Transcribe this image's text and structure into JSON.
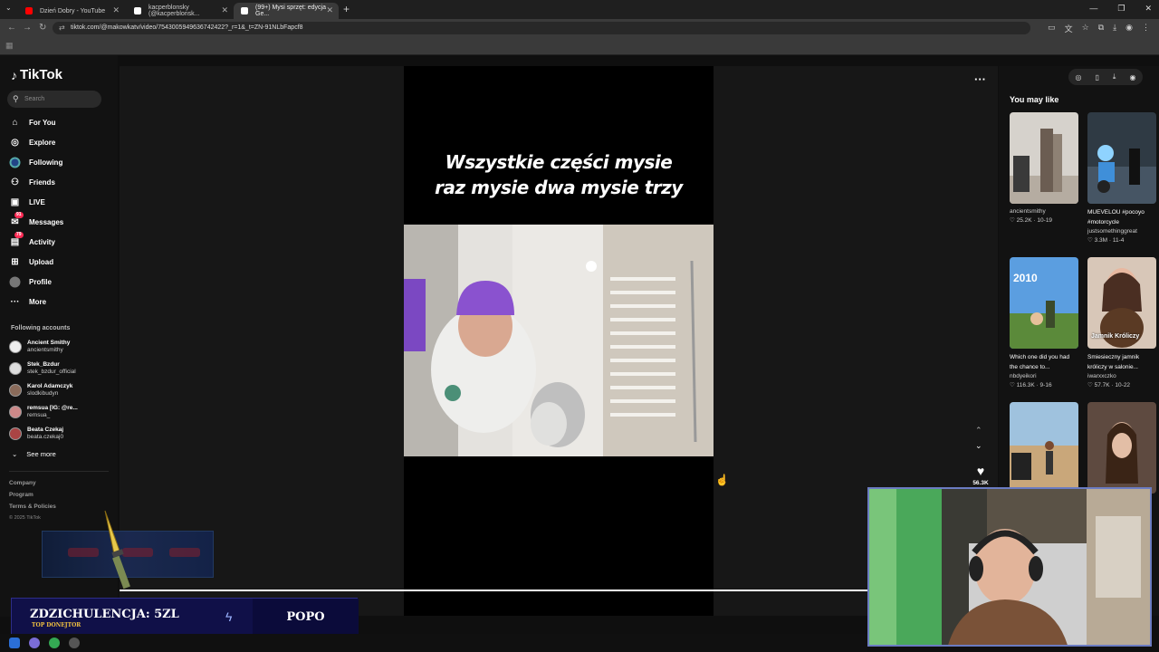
{
  "browser": {
    "tabs": [
      {
        "title": "Dzień Dobry - YouTube",
        "favicon_color": "#ff0000"
      },
      {
        "title": "kacperblonsky (@kacperblonsk...",
        "favicon_color": "#ffffff"
      },
      {
        "title": "(99+) Mysi sprzęt: edycja Ge...",
        "favicon_color": "#ffffff"
      }
    ],
    "url": "tiktok.com/@makowkatv/video/7543005949636742422?_r=1&_t=ZN-91NLbFapcf8"
  },
  "tiktok": {
    "logo": "TikTok",
    "search_placeholder": "Search",
    "nav": [
      {
        "label": "For You",
        "icon": "home-icon"
      },
      {
        "label": "Explore",
        "icon": "compass-icon"
      },
      {
        "label": "Following",
        "icon": "following-icon"
      },
      {
        "label": "Friends",
        "icon": "friends-icon"
      },
      {
        "label": "LIVE",
        "icon": "live-icon"
      },
      {
        "label": "Messages",
        "icon": "message-icon",
        "badge": "91"
      },
      {
        "label": "Activity",
        "icon": "inbox-icon",
        "badge": "79"
      },
      {
        "label": "Upload",
        "icon": "upload-icon"
      },
      {
        "label": "Profile",
        "icon": "profile-icon"
      },
      {
        "label": "More",
        "icon": "more-icon"
      }
    ],
    "following_header": "Following accounts",
    "following_accounts": [
      {
        "name": "Ancient Smithy",
        "handle": "ancientsmithy"
      },
      {
        "name": "Stek_Bzdur",
        "handle": "stek_bzdur_official"
      },
      {
        "name": "Karol Adamczyk",
        "handle": "slodkibudyn"
      },
      {
        "name": "remsua [IG: @re...",
        "handle": "remsua_"
      },
      {
        "name": "Beata Czekaj",
        "handle": "beata.czekaj0"
      }
    ],
    "see_more": "See more",
    "footer": [
      "Company",
      "Program",
      "Terms & Policies"
    ],
    "copyright": "© 2025 TikTok"
  },
  "video": {
    "caption_line1": "Wszystkie części mysie",
    "caption_line2": "raz mysie dwa mysie trzy",
    "likes": "56.3K"
  },
  "rail": {
    "header": "You may like",
    "cards": [
      {
        "title": "",
        "author": "ancientsmithy",
        "likes": "25.2K",
        "date": "10-19",
        "thumb_color": "#d6d2cc"
      },
      {
        "title": "MUEVELOU #pocoyo #motorcycle",
        "author": "justsomethinggreat",
        "likes": "3.3M",
        "date": "11-4",
        "thumb_color": "#2f3a44"
      },
      {
        "title": "Which one did you had the chance to...",
        "author": "nbdyeikori",
        "likes": "116.3K",
        "date": "9-16",
        "thumb_color": "#4c86c9",
        "overlay_text": "2010"
      },
      {
        "title": "Smiesieczny jamnik króliczy w salonie...",
        "author": "iwarxxczko",
        "likes": "57.7K",
        "date": "10-22",
        "thumb_color": "#c49a80",
        "overlay_text": "Jamnik Króliczy"
      },
      {
        "title": "",
        "author": "",
        "likes": "",
        "date": "",
        "thumb_color": "#c9a77a"
      },
      {
        "title": "",
        "author": "",
        "likes": "",
        "date": "",
        "thumb_color": "#5e4a40"
      }
    ]
  },
  "stream": {
    "donor_amount": "ZDZICHULENCJA: 5ZL",
    "donor_label": "TOP DONEJTOR",
    "donor_right": "POPO"
  }
}
